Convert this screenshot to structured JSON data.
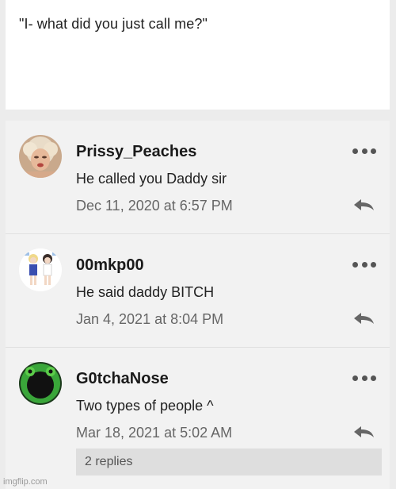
{
  "post": {
    "text": "\"I- what did you just call me?\""
  },
  "comments": [
    {
      "username": "Prissy_Peaches",
      "text": "He called you Daddy sir",
      "timestamp": "Dec 11, 2020 at 6:57 PM",
      "avatar_icon": "woman-portrait-avatar"
    },
    {
      "username": "00mkp00",
      "text": "He said daddy BITCH",
      "timestamp": "Jan 4, 2021 at 8:04 PM",
      "avatar_icon": "anime-characters-avatar"
    },
    {
      "username": "G0tchaNose",
      "text": "Two types of people ^",
      "timestamp": "Mar 18, 2021 at 5:02 AM",
      "avatar_icon": "green-frog-avatar"
    }
  ],
  "replies": {
    "label": "2 replies"
  },
  "watermark": "imgflip.com",
  "colors": {
    "background": "#ececec",
    "card": "#ffffff",
    "comment_bg": "#f2f2f2",
    "icon": "#555555"
  }
}
